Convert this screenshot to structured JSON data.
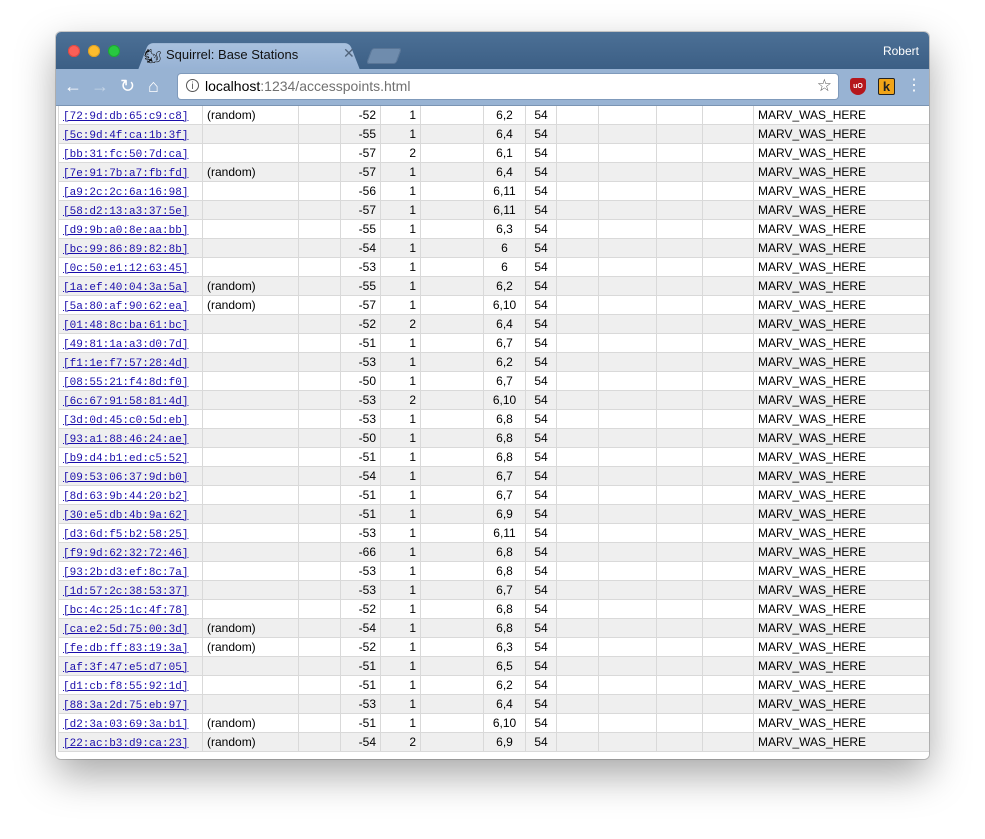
{
  "window": {
    "tab_title": "Squirrel: Base Stations",
    "profile": "Robert",
    "url_host": "localhost",
    "url_path": ":1234/accesspoints.html",
    "icons": [
      "back-icon",
      "forward-icon",
      "reload-icon",
      "home-icon",
      "info-icon",
      "star-icon",
      "ublock-icon",
      "keepa-icon",
      "menu-icon"
    ]
  },
  "rows": [
    {
      "mac": "[72:9d:db:65:c9:c8]",
      "rand": "(random)",
      "rssi": "-52",
      "n": "1",
      "ch": "6,2",
      "rate": "54",
      "ssid": "MARV_WAS_HERE"
    },
    {
      "mac": "[5c:9d:4f:ca:1b:3f]",
      "rand": "",
      "rssi": "-55",
      "n": "1",
      "ch": "6,4",
      "rate": "54",
      "ssid": "MARV_WAS_HERE"
    },
    {
      "mac": "[bb:31:fc:50:7d:ca]",
      "rand": "",
      "rssi": "-57",
      "n": "2",
      "ch": "6,1",
      "rate": "54",
      "ssid": "MARV_WAS_HERE"
    },
    {
      "mac": "[7e:91:7b:a7:fb:fd]",
      "rand": "(random)",
      "rssi": "-57",
      "n": "1",
      "ch": "6,4",
      "rate": "54",
      "ssid": "MARV_WAS_HERE"
    },
    {
      "mac": "[a9:2c:2c:6a:16:98]",
      "rand": "",
      "rssi": "-56",
      "n": "1",
      "ch": "6,11",
      "rate": "54",
      "ssid": "MARV_WAS_HERE"
    },
    {
      "mac": "[58:d2:13:a3:37:5e]",
      "rand": "",
      "rssi": "-57",
      "n": "1",
      "ch": "6,11",
      "rate": "54",
      "ssid": "MARV_WAS_HERE"
    },
    {
      "mac": "[d9:9b:a0:8e:aa:bb]",
      "rand": "",
      "rssi": "-55",
      "n": "1",
      "ch": "6,3",
      "rate": "54",
      "ssid": "MARV_WAS_HERE"
    },
    {
      "mac": "[bc:99:86:89:82:8b]",
      "rand": "",
      "rssi": "-54",
      "n": "1",
      "ch": "6",
      "rate": "54",
      "ssid": "MARV_WAS_HERE"
    },
    {
      "mac": "[0c:50:e1:12:63:45]",
      "rand": "",
      "rssi": "-53",
      "n": "1",
      "ch": "6",
      "rate": "54",
      "ssid": "MARV_WAS_HERE"
    },
    {
      "mac": "[1a:ef:40:04:3a:5a]",
      "rand": "(random)",
      "rssi": "-55",
      "n": "1",
      "ch": "6,2",
      "rate": "54",
      "ssid": "MARV_WAS_HERE"
    },
    {
      "mac": "[5a:80:af:90:62:ea]",
      "rand": "(random)",
      "rssi": "-57",
      "n": "1",
      "ch": "6,10",
      "rate": "54",
      "ssid": "MARV_WAS_HERE"
    },
    {
      "mac": "[01:48:8c:ba:61:bc]",
      "rand": "",
      "rssi": "-52",
      "n": "2",
      "ch": "6,4",
      "rate": "54",
      "ssid": "MARV_WAS_HERE"
    },
    {
      "mac": "[49:81:1a:a3:d0:7d]",
      "rand": "",
      "rssi": "-51",
      "n": "1",
      "ch": "6,7",
      "rate": "54",
      "ssid": "MARV_WAS_HERE"
    },
    {
      "mac": "[f1:1e:f7:57:28:4d]",
      "rand": "",
      "rssi": "-53",
      "n": "1",
      "ch": "6,2",
      "rate": "54",
      "ssid": "MARV_WAS_HERE"
    },
    {
      "mac": "[08:55:21:f4:8d:f0]",
      "rand": "",
      "rssi": "-50",
      "n": "1",
      "ch": "6,7",
      "rate": "54",
      "ssid": "MARV_WAS_HERE"
    },
    {
      "mac": "[6c:67:91:58:81:4d]",
      "rand": "",
      "rssi": "-53",
      "n": "2",
      "ch": "6,10",
      "rate": "54",
      "ssid": "MARV_WAS_HERE"
    },
    {
      "mac": "[3d:0d:45:c0:5d:eb]",
      "rand": "",
      "rssi": "-53",
      "n": "1",
      "ch": "6,8",
      "rate": "54",
      "ssid": "MARV_WAS_HERE"
    },
    {
      "mac": "[93:a1:88:46:24:ae]",
      "rand": "",
      "rssi": "-50",
      "n": "1",
      "ch": "6,8",
      "rate": "54",
      "ssid": "MARV_WAS_HERE"
    },
    {
      "mac": "[b9:d4:b1:ed:c5:52]",
      "rand": "",
      "rssi": "-51",
      "n": "1",
      "ch": "6,8",
      "rate": "54",
      "ssid": "MARV_WAS_HERE"
    },
    {
      "mac": "[09:53:06:37:9d:b0]",
      "rand": "",
      "rssi": "-54",
      "n": "1",
      "ch": "6,7",
      "rate": "54",
      "ssid": "MARV_WAS_HERE"
    },
    {
      "mac": "[8d:63:9b:44:20:b2]",
      "rand": "",
      "rssi": "-51",
      "n": "1",
      "ch": "6,7",
      "rate": "54",
      "ssid": "MARV_WAS_HERE"
    },
    {
      "mac": "[30:e5:db:4b:9a:62]",
      "rand": "",
      "rssi": "-51",
      "n": "1",
      "ch": "6,9",
      "rate": "54",
      "ssid": "MARV_WAS_HERE"
    },
    {
      "mac": "[d3:6d:f5:b2:58:25]",
      "rand": "",
      "rssi": "-53",
      "n": "1",
      "ch": "6,11",
      "rate": "54",
      "ssid": "MARV_WAS_HERE"
    },
    {
      "mac": "[f9:9d:62:32:72:46]",
      "rand": "",
      "rssi": "-66",
      "n": "1",
      "ch": "6,8",
      "rate": "54",
      "ssid": "MARV_WAS_HERE"
    },
    {
      "mac": "[93:2b:d3:ef:8c:7a]",
      "rand": "",
      "rssi": "-53",
      "n": "1",
      "ch": "6,8",
      "rate": "54",
      "ssid": "MARV_WAS_HERE"
    },
    {
      "mac": "[1d:57:2c:38:53:37]",
      "rand": "",
      "rssi": "-53",
      "n": "1",
      "ch": "6,7",
      "rate": "54",
      "ssid": "MARV_WAS_HERE"
    },
    {
      "mac": "[bc:4c:25:1c:4f:78]",
      "rand": "",
      "rssi": "-52",
      "n": "1",
      "ch": "6,8",
      "rate": "54",
      "ssid": "MARV_WAS_HERE"
    },
    {
      "mac": "[ca:e2:5d:75:00:3d]",
      "rand": "(random)",
      "rssi": "-54",
      "n": "1",
      "ch": "6,8",
      "rate": "54",
      "ssid": "MARV_WAS_HERE"
    },
    {
      "mac": "[fe:db:ff:83:19:3a]",
      "rand": "(random)",
      "rssi": "-52",
      "n": "1",
      "ch": "6,3",
      "rate": "54",
      "ssid": "MARV_WAS_HERE"
    },
    {
      "mac": "[af:3f:47:e5:d7:05]",
      "rand": "",
      "rssi": "-51",
      "n": "1",
      "ch": "6,5",
      "rate": "54",
      "ssid": "MARV_WAS_HERE"
    },
    {
      "mac": "[d1:cb:f8:55:92:1d]",
      "rand": "",
      "rssi": "-51",
      "n": "1",
      "ch": "6,2",
      "rate": "54",
      "ssid": "MARV_WAS_HERE"
    },
    {
      "mac": "[88:3a:2d:75:eb:97]",
      "rand": "",
      "rssi": "-53",
      "n": "1",
      "ch": "6,4",
      "rate": "54",
      "ssid": "MARV_WAS_HERE"
    },
    {
      "mac": "[d2:3a:03:69:3a:b1]",
      "rand": "(random)",
      "rssi": "-51",
      "n": "1",
      "ch": "6,10",
      "rate": "54",
      "ssid": "MARV_WAS_HERE"
    },
    {
      "mac": "[22:ac:b3:d9:ca:23]",
      "rand": "(random)",
      "rssi": "-54",
      "n": "2",
      "ch": "6,9",
      "rate": "54",
      "ssid": "MARV_WAS_HERE"
    }
  ]
}
